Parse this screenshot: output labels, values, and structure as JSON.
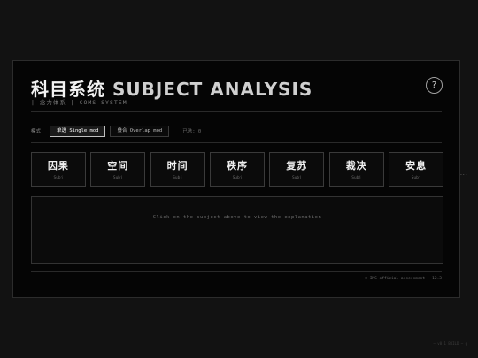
{
  "header": {
    "title_cn": "科目系统",
    "title_en": "SUBJECT ANALYSIS",
    "subtitle": "| 念力体系 | COMS SYSTEM",
    "help_label": "?"
  },
  "mode": {
    "label": "模式",
    "options": [
      {
        "label": "单选 Single mod",
        "active": true
      },
      {
        "label": "叠合 Overlap mod",
        "active": false
      }
    ],
    "selected_count": "已选: 0"
  },
  "subjects": [
    {
      "cn": "因果",
      "sub": "Subj"
    },
    {
      "cn": "空间",
      "sub": "Subj"
    },
    {
      "cn": "时间",
      "sub": "Subj"
    },
    {
      "cn": "秩序",
      "sub": "Subj"
    },
    {
      "cn": "复苏",
      "sub": "Subj"
    },
    {
      "cn": "裁决",
      "sub": "Subj"
    },
    {
      "cn": "安息",
      "sub": "Subj"
    }
  ],
  "explanation": {
    "hint": "Click on the subject above to view the explanation"
  },
  "footer": {
    "text": "© IMS official assessment · 12.3"
  },
  "side_menu_label": "···",
  "corner_text": "— v0.1 BUILD — g"
}
